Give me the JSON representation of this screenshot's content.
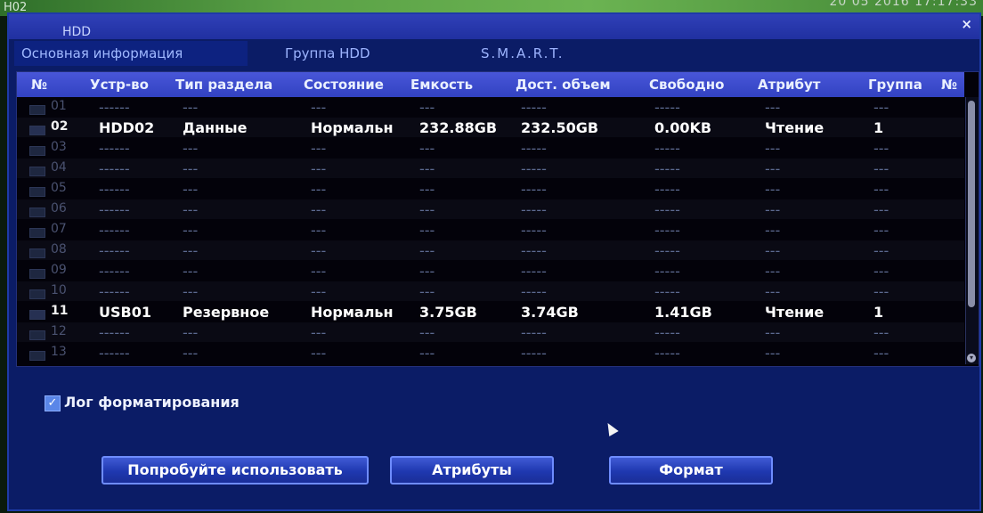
{
  "topbar": {
    "title": "H02",
    "clock": "20  05  2016  17:17:33"
  },
  "window": {
    "title": "HDD",
    "close": "×"
  },
  "tabs": [
    "Основная информация",
    "Группа HDD",
    "S.M.A.R.T."
  ],
  "columns": [
    "№",
    "Устр-во",
    "Тип раздела",
    "Состояние",
    "Емкость",
    "Дост. объем",
    "Свободно",
    "Атрибут",
    "Группа",
    "№"
  ],
  "rows": [
    {
      "num": "01",
      "device": "------",
      "type": "---",
      "state": "---",
      "capacity": "---",
      "available": "-----",
      "free": "-----",
      "attr": "---",
      "group": "---"
    },
    {
      "num": "02",
      "device": "HDD02",
      "type": "Данные",
      "state": "Нормальн",
      "capacity": "232.88GB",
      "available": "232.50GB",
      "free": "0.00KB",
      "attr": "Чтение",
      "group": "1"
    },
    {
      "num": "03",
      "device": "------",
      "type": "---",
      "state": "---",
      "capacity": "---",
      "available": "-----",
      "free": "-----",
      "attr": "---",
      "group": "---"
    },
    {
      "num": "04",
      "device": "------",
      "type": "---",
      "state": "---",
      "capacity": "---",
      "available": "-----",
      "free": "-----",
      "attr": "---",
      "group": "---"
    },
    {
      "num": "05",
      "device": "------",
      "type": "---",
      "state": "---",
      "capacity": "---",
      "available": "-----",
      "free": "-----",
      "attr": "---",
      "group": "---"
    },
    {
      "num": "06",
      "device": "------",
      "type": "---",
      "state": "---",
      "capacity": "---",
      "available": "-----",
      "free": "-----",
      "attr": "---",
      "group": "---"
    },
    {
      "num": "07",
      "device": "------",
      "type": "---",
      "state": "---",
      "capacity": "---",
      "available": "-----",
      "free": "-----",
      "attr": "---",
      "group": "---"
    },
    {
      "num": "08",
      "device": "------",
      "type": "---",
      "state": "---",
      "capacity": "---",
      "available": "-----",
      "free": "-----",
      "attr": "---",
      "group": "---"
    },
    {
      "num": "09",
      "device": "------",
      "type": "---",
      "state": "---",
      "capacity": "---",
      "available": "-----",
      "free": "-----",
      "attr": "---",
      "group": "---"
    },
    {
      "num": "10",
      "device": "------",
      "type": "---",
      "state": "---",
      "capacity": "---",
      "available": "-----",
      "free": "-----",
      "attr": "---",
      "group": "---"
    },
    {
      "num": "11",
      "device": "USB01",
      "type": "Резервное",
      "state": "Нормальн",
      "capacity": "3.75GB",
      "available": "3.74GB",
      "free": "1.41GB",
      "attr": "Чтение",
      "group": "1"
    },
    {
      "num": "12",
      "device": "------",
      "type": "---",
      "state": "---",
      "capacity": "---",
      "available": "-----",
      "free": "-----",
      "attr": "---",
      "group": "---"
    },
    {
      "num": "13",
      "device": "------",
      "type": "---",
      "state": "---",
      "capacity": "---",
      "available": "-----",
      "free": "-----",
      "attr": "---",
      "group": "---"
    }
  ],
  "log": {
    "label": "Лог форматирования",
    "checked": "✓"
  },
  "buttons": {
    "try": "Попробуйте использовать",
    "attributes": "Атрибуты",
    "format": "Формат"
  }
}
